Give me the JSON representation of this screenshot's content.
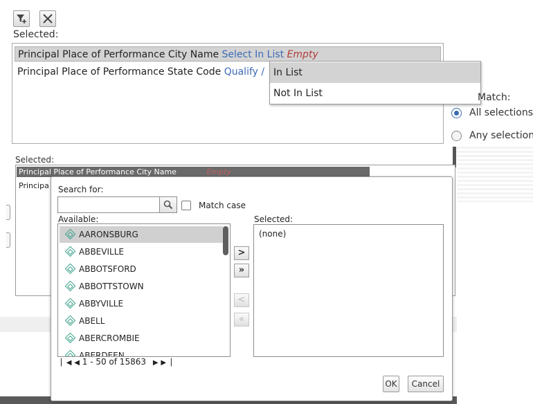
{
  "toolbar": {
    "add_filter_icon": "filter-add-icon",
    "clear_icon": "clear-icon"
  },
  "top": {
    "selected_label": "Selected:",
    "rows": [
      {
        "field": "Principal Place of Performance City Name",
        "link": "Select In List",
        "status": "Empty"
      },
      {
        "field": "Principal Place of Performance State Code",
        "link": "Qualify /"
      }
    ],
    "dropdown": [
      "In List",
      "Not In List"
    ],
    "match_label": "Match:",
    "match_options": [
      "All selections",
      "Any selection"
    ]
  },
  "lower": {
    "selected_label": "Selected:",
    "row1": "Principal Place of Performance City Name",
    "row1_status": "Empty",
    "row2": "Principa"
  },
  "dialog": {
    "search_label": "Search for:",
    "search_value": "",
    "match_case_label": "Match case",
    "available_label": "Available:",
    "selected_label": "Selected:",
    "available_items": [
      "AARONSBURG",
      "ABBEVILLE",
      "ABBOTSFORD",
      "ABBOTTSTOWN",
      "ABBYVILLE",
      "ABELL",
      "ABERCROMBIE",
      "ABERDEEN"
    ],
    "selected_items": [
      "(none)"
    ],
    "pager_text": "1 - 50 of 15863",
    "ok_label": "OK",
    "cancel_label": "Cancel",
    "move_buttons": [
      ">",
      "»",
      "<",
      "«"
    ]
  },
  "colors": {
    "accent_link": "#3b6bb5",
    "empty_status": "#b23a3a",
    "item_icon": "#3aa08a"
  }
}
